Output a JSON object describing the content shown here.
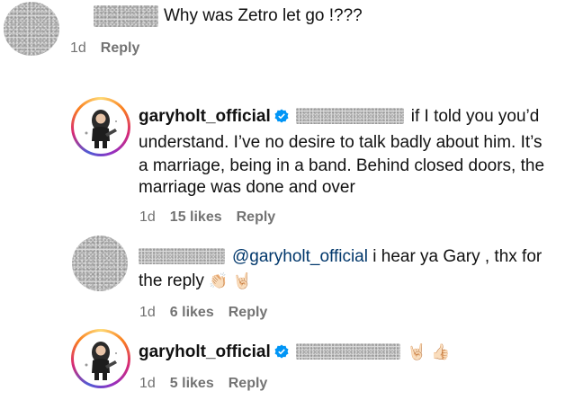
{
  "comments": [
    {
      "text": "Why was Zetro let go !???",
      "time": "1d",
      "reply": "Reply"
    },
    {
      "username": "garyholt_official",
      "line1": "if I told you you’d",
      "line2": "understand. I’ve no desire to talk badly about him. It’s",
      "line3": "a marriage, being in a band. Behind closed doors, the",
      "line4": "marriage was done and over",
      "time": "1d",
      "likes": "15 likes",
      "reply": "Reply"
    },
    {
      "mention": "@garyholt_official",
      "text1": "i hear ya Gary , thx for",
      "text2": "the reply",
      "emojis": "👏🏻 🤘🏻",
      "time": "1d",
      "likes": "6 likes",
      "reply": "Reply"
    },
    {
      "username": "garyholt_official",
      "emojis": "🤘🏻 👍🏻",
      "time": "1d",
      "likes": "5 likes",
      "reply": "Reply"
    }
  ],
  "icons": {
    "verified": "verified-badge-icon",
    "verified_color": "#0095f6"
  }
}
